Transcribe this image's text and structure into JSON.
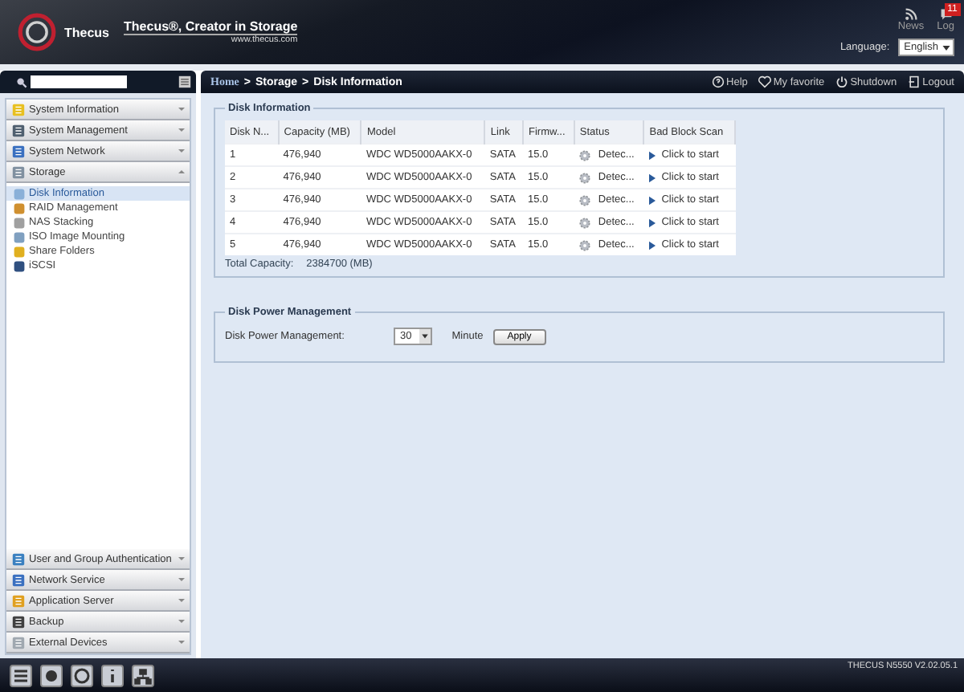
{
  "header": {
    "logo_text": "Thecus",
    "tagline": "Thecus®, Creator in Storage",
    "url": "www.thecus.com",
    "links": [
      {
        "label": "News"
      },
      {
        "label": "Log",
        "badge": "11"
      }
    ],
    "language_label": "Language:",
    "language_value": "English"
  },
  "sidebar": {
    "groups": [
      {
        "label": "System Information",
        "expanded": false
      },
      {
        "label": "System Management",
        "expanded": false
      },
      {
        "label": "System Network",
        "expanded": false
      },
      {
        "label": "Storage",
        "expanded": true,
        "children": [
          {
            "label": "Disk Information",
            "selected": true
          },
          {
            "label": "RAID Management",
            "selected": false
          },
          {
            "label": "NAS Stacking",
            "selected": false
          },
          {
            "label": "ISO Image Mounting",
            "selected": false
          },
          {
            "label": "Share Folders",
            "selected": false
          },
          {
            "label": "iSCSI",
            "selected": false
          }
        ]
      },
      {
        "label": "User and Group Authentication",
        "expanded": false
      },
      {
        "label": "Network Service",
        "expanded": false
      },
      {
        "label": "Application Server",
        "expanded": false
      },
      {
        "label": "Backup",
        "expanded": false
      },
      {
        "label": "External Devices",
        "expanded": false
      }
    ]
  },
  "breadcrumb": {
    "items": [
      "Home",
      "Storage",
      "Disk Information"
    ],
    "separator": ">"
  },
  "toolbar": [
    "Help",
    "My favorite",
    "Shutdown",
    "Logout"
  ],
  "disk_info": {
    "title": "Disk Information",
    "columns": [
      "Disk N...",
      "Capacity (MB)",
      "Model",
      "Link",
      "Firmw...",
      "Status",
      "Bad Block Scan"
    ],
    "rows": [
      [
        "1",
        "476,940",
        "WDC WD5000AAKX-0",
        "SATA",
        "15.0",
        "Detec...",
        "Click to start"
      ],
      [
        "2",
        "476,940",
        "WDC WD5000AAKX-0",
        "SATA",
        "15.0",
        "Detec...",
        "Click to start"
      ],
      [
        "3",
        "476,940",
        "WDC WD5000AAKX-0",
        "SATA",
        "15.0",
        "Detec...",
        "Click to start"
      ],
      [
        "4",
        "476,940",
        "WDC WD5000AAKX-0",
        "SATA",
        "15.0",
        "Detec...",
        "Click to start"
      ],
      [
        "5",
        "476,940",
        "WDC WD5000AAKX-0",
        "SATA",
        "15.0",
        "Detec...",
        "Click to start"
      ]
    ],
    "total_label": "Total Capacity:",
    "total_value": "2384700 (MB)"
  },
  "power": {
    "title": "Disk Power Management",
    "label": "Disk Power Management:",
    "value": "30",
    "unit": "Minute",
    "button": "Apply"
  },
  "footer": {
    "version": "THECUS N5550 V2.02.05.1"
  }
}
